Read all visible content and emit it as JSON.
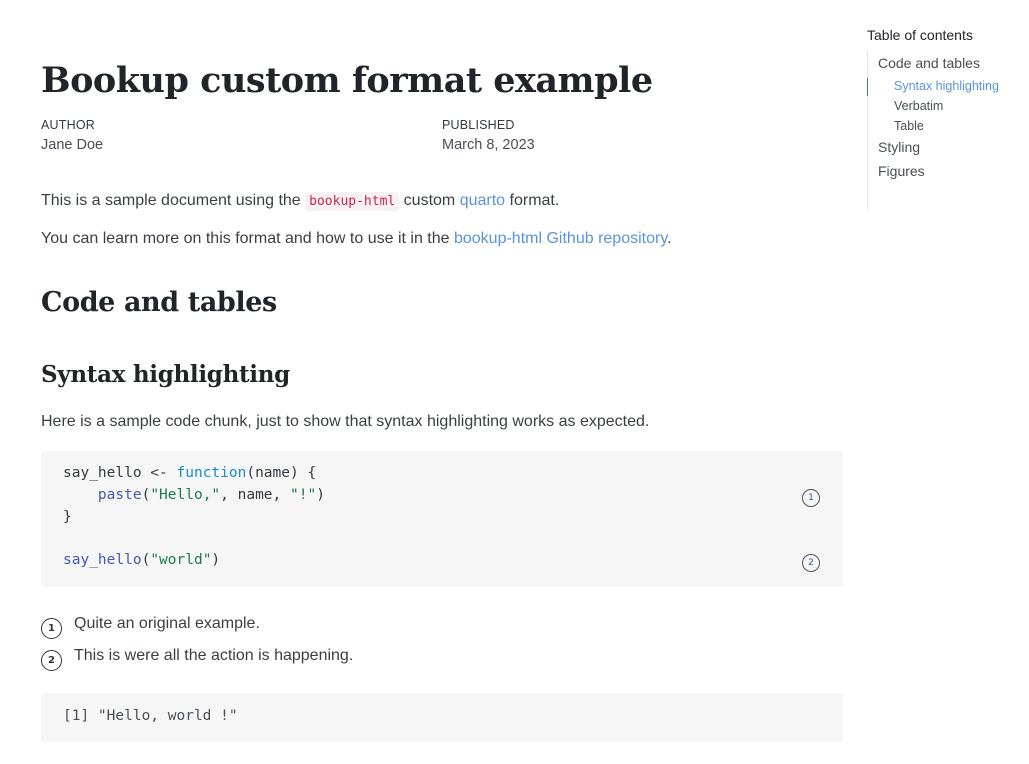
{
  "document": {
    "title": "Bookup custom format example",
    "meta": {
      "author_label": "AUTHOR",
      "author": "Jane Doe",
      "published_label": "PUBLISHED",
      "published": "March 8, 2023"
    },
    "intro": {
      "p1_before": "This is a sample document using the ",
      "p1_code": "bookup-html",
      "p1_middle": " custom ",
      "p1_link": "quarto",
      "p1_after": " format.",
      "p2_before": "You can learn more on this format and how to use it in the ",
      "p2_link": "bookup-html Github repository",
      "p2_after": "."
    },
    "section_heading": "Code and tables",
    "subsection_heading": "Syntax highlighting",
    "subsection_text": "Here is a sample code chunk, just to show that syntax highlighting works as expected.",
    "code": {
      "line1": {
        "a": "say_hello <- ",
        "kw": "function",
        "b": "(name) {"
      },
      "line2": {
        "indent": "    ",
        "fn": "paste",
        "a": "(",
        "s1": "\"Hello,\"",
        "b": ", name, ",
        "s2": "\"!\"",
        "c": ")"
      },
      "line3": "}",
      "line5": {
        "fn": "say_hello",
        "a": "(",
        "s": "\"world\"",
        "b": ")"
      },
      "annotation_markers": [
        "1",
        "2"
      ]
    },
    "annotations": [
      {
        "num": "1",
        "text": "Quite an original example."
      },
      {
        "num": "2",
        "text": "This is were all the action is happening."
      }
    ],
    "output": "[1] \"Hello, world !\""
  },
  "toc": {
    "title": "Table of contents",
    "items": [
      {
        "label": "Code and tables",
        "level": 1
      },
      {
        "label": "Syntax highlighting",
        "level": 2,
        "active": true
      },
      {
        "label": "Verbatim",
        "level": 2
      },
      {
        "label": "Table",
        "level": 2
      },
      {
        "label": "Styling",
        "level": 1
      },
      {
        "label": "Figures",
        "level": 1
      }
    ]
  },
  "colors": {
    "link": "#5b93d6",
    "inline_code": "#c7254e",
    "keyword": "#1b8fc4",
    "function": "#4758ab",
    "string": "#20794d",
    "toc_active_bar": "#2780e3"
  }
}
